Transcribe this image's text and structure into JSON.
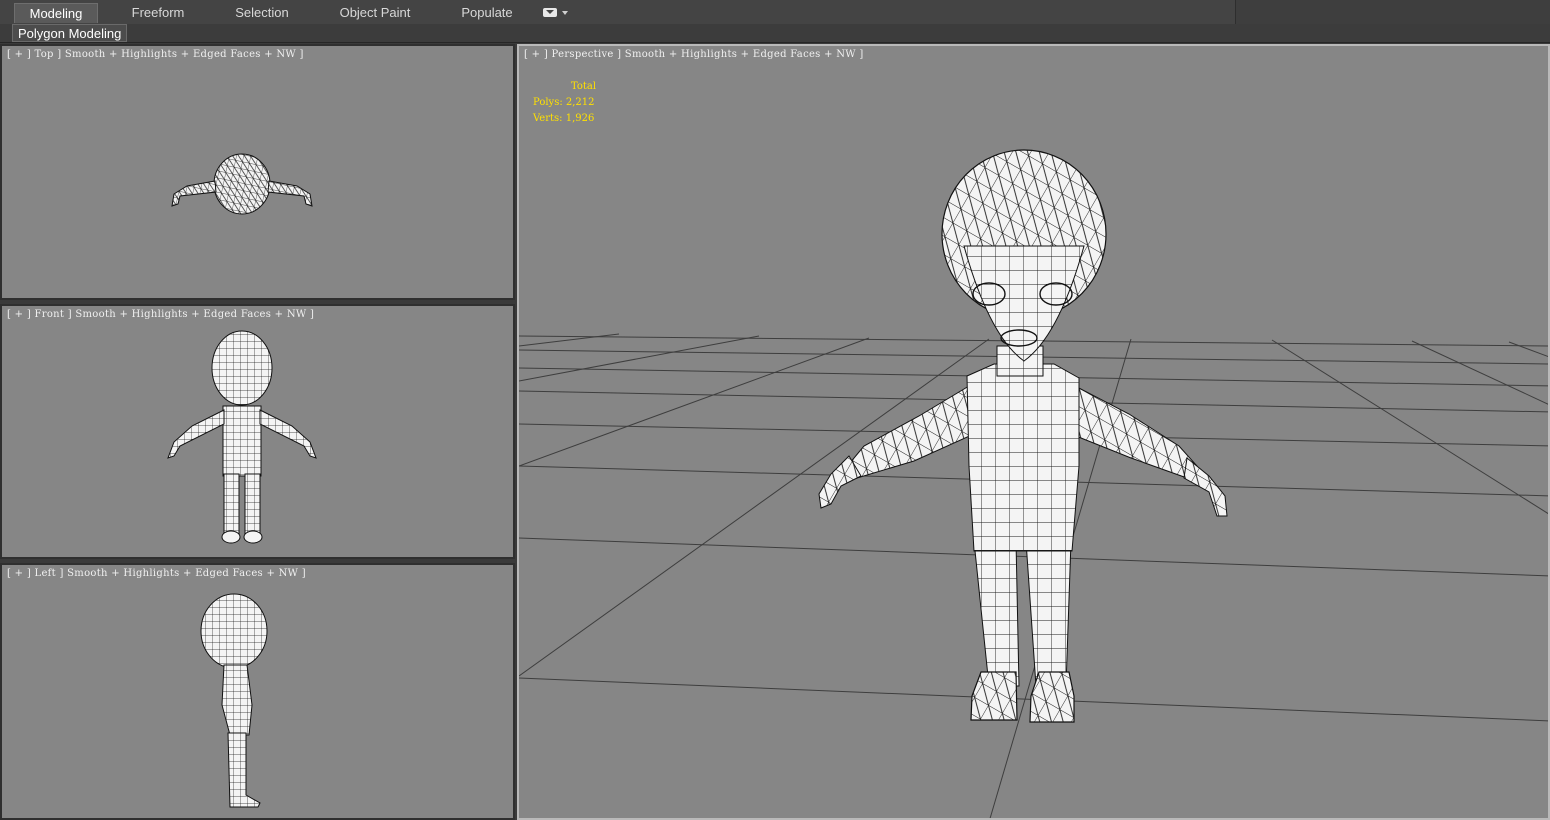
{
  "ribbon": {
    "tabs": [
      {
        "label": "Modeling",
        "active": true
      },
      {
        "label": "Freeform",
        "active": false
      },
      {
        "label": "Selection",
        "active": false
      },
      {
        "label": "Object Paint",
        "active": false
      },
      {
        "label": "Populate",
        "active": false
      }
    ],
    "dropdown_icon": "ribbon-options-icon",
    "subtab": "Polygon Modeling"
  },
  "viewports": {
    "top": {
      "label": "[ + ] Top ] Smooth + Highlights + Edged Faces + NW ]"
    },
    "front": {
      "label": "[ + ] Front ] Smooth + Highlights + Edged Faces + NW ]"
    },
    "left": {
      "label": "[ + ] Left ] Smooth + Highlights + Edged Faces + NW ]"
    },
    "perspective": {
      "label": "[ + ] Perspective ] Smooth + Highlights + Edged Faces + NW ]",
      "stats": {
        "header": "Total",
        "polys": "Polys: 2,212",
        "verts": "Verts: 1,926"
      }
    }
  },
  "colors": {
    "viewport_bg": "#868686",
    "stats_text": "#ffe000",
    "mesh_fill": "#f4f4f4",
    "wire": "#1a1a1a",
    "grid": "#444444"
  }
}
